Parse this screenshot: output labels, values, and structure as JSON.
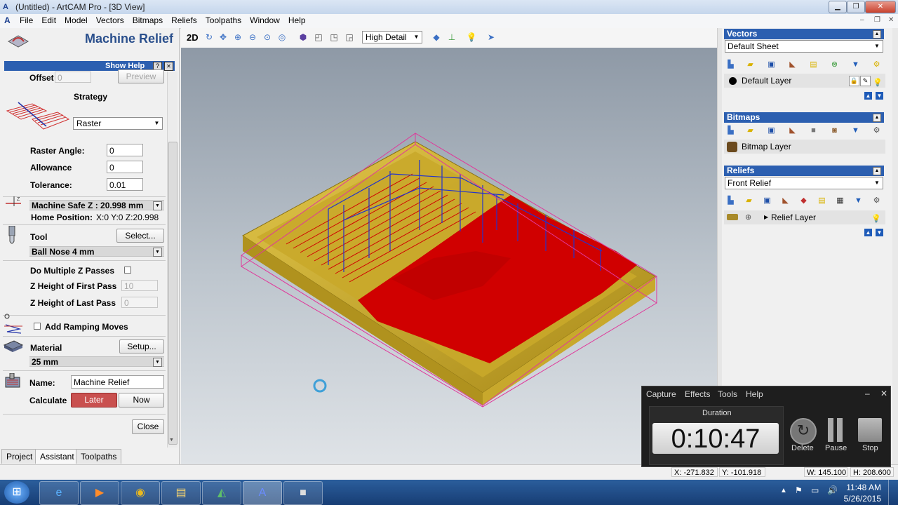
{
  "window": {
    "title": "(Untitled) - ArtCAM Pro - [3D View]",
    "min": "▁",
    "max": "❐",
    "close": "✕"
  },
  "menu": [
    "File",
    "Edit",
    "Model",
    "Vectors",
    "Bitmaps",
    "Reliefs",
    "Toolpaths",
    "Window",
    "Help"
  ],
  "panel": {
    "title": "Machine Relief",
    "show_help": "Show Help",
    "help_q": "?",
    "help_x": "✕",
    "offset_label": "Offset",
    "offset_value": "0",
    "preview": "Preview",
    "strategy_label": "Strategy",
    "strategy_value": "Raster",
    "raster_angle_label": "Raster Angle:",
    "raster_angle_value": "0",
    "allowance_label": "Allowance",
    "allowance_value": "0",
    "tolerance_label": "Tolerance:",
    "tolerance_value": "0.01",
    "safe_z": "Machine Safe Z : 20.998 mm",
    "home_label": "Home Position:",
    "home_value": "X:0 Y:0 Z:20.998",
    "tool_label": "Tool",
    "select_btn": "Select...",
    "tool_value": "Ball Nose 4 mm",
    "multi_z_label": "Do Multiple Z Passes",
    "z_first_label": "Z Height of First Pass",
    "z_first_value": "10",
    "z_last_label": "Z Height of Last Pass",
    "z_last_value": "0",
    "ramping_label": "Add Ramping Moves",
    "material_label": "Material",
    "setup_btn": "Setup...",
    "material_value": "25 mm",
    "name_label": "Name:",
    "name_value": "Machine Relief",
    "calculate_label": "Calculate",
    "later_btn": "Later",
    "now_btn": "Now",
    "close_btn": "Close"
  },
  "tabs": [
    "Project",
    "Assistant",
    "Toolpaths"
  ],
  "toolbar3d": {
    "label_2d": "2D",
    "detail_value": "High Detail"
  },
  "vectors": {
    "header": "Vectors",
    "sheet": "Default Sheet",
    "layer": "Default Layer"
  },
  "bitmaps": {
    "header": "Bitmaps",
    "layer": "Bitmap Layer"
  },
  "reliefs": {
    "header": "Reliefs",
    "relief": "Front Relief",
    "layer": "Relief Layer"
  },
  "status": {
    "x": "X: -271.832",
    "y": "Y: -101.918",
    "w": "W: 145.100",
    "h": "H: 208.600"
  },
  "recorder": {
    "menu": [
      "Capture",
      "Effects",
      "Tools",
      "Help"
    ],
    "min": "–",
    "close": "✕",
    "duration_label": "Duration",
    "time": "0:10:47",
    "delete": "Delete",
    "pause": "Pause",
    "stop": "Stop"
  },
  "clock": {
    "time": "11:48 AM",
    "date": "5/26/2015"
  },
  "colors": {
    "relief_gold": "#c9a82a",
    "toolpath_red": "#d00000",
    "toolpath_blue": "#2233cc",
    "bbox_pink": "#e0389a",
    "header_blue": "#2c5fb0",
    "later_red": "#c9504f"
  }
}
